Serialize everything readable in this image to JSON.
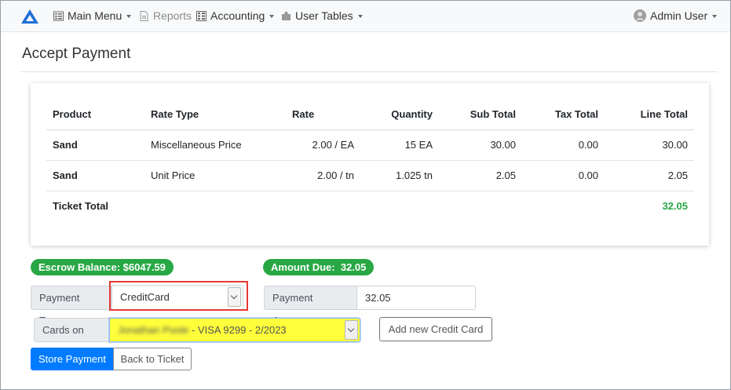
{
  "nav": {
    "main_menu": "Main Menu",
    "reports": "Reports",
    "accounting": "Accounting",
    "user_tables": "User Tables",
    "user": "Admin User"
  },
  "page": {
    "title": "Accept Payment"
  },
  "table": {
    "headers": [
      "Product",
      "Rate Type",
      "Rate",
      "Quantity",
      "Sub Total",
      "Tax Total",
      "Line Total"
    ],
    "rows": [
      {
        "product": "Sand",
        "rate_type": "Miscellaneous Price",
        "rate": "2.00 / EA",
        "quantity": "15 EA",
        "sub_total": "30.00",
        "tax_total": "0.00",
        "line_total": "30.00"
      },
      {
        "product": "Sand",
        "rate_type": "Unit Price",
        "rate": "2.00 / tn",
        "quantity": "1.025 tn",
        "sub_total": "2.05",
        "tax_total": "0.00",
        "line_total": "2.05"
      }
    ],
    "ticket_total_label": "Ticket Total",
    "ticket_total_value": "32.05"
  },
  "escrow": {
    "label": "Escrow Balance:",
    "value": "$6047.59"
  },
  "amount_due": {
    "label": "Amount Due:",
    "value": "32.05"
  },
  "payment_type": {
    "label": "Payment Type",
    "value": "CreditCard"
  },
  "payment_amount": {
    "label": "Payment Amount",
    "value": "32.05"
  },
  "cards": {
    "label": "Cards on File",
    "value_name": "Jonathan Poole",
    "value_rest": " - VISA 9299 - 2/2023"
  },
  "buttons": {
    "add_card": "Add new Credit Card",
    "store_payment": "Store Payment",
    "back_to_ticket": "Back to Ticket"
  },
  "colors": {
    "primary": "#007bff",
    "success": "#28a745",
    "highlight": "#ffff3b",
    "alert_outline": "#e53935"
  }
}
